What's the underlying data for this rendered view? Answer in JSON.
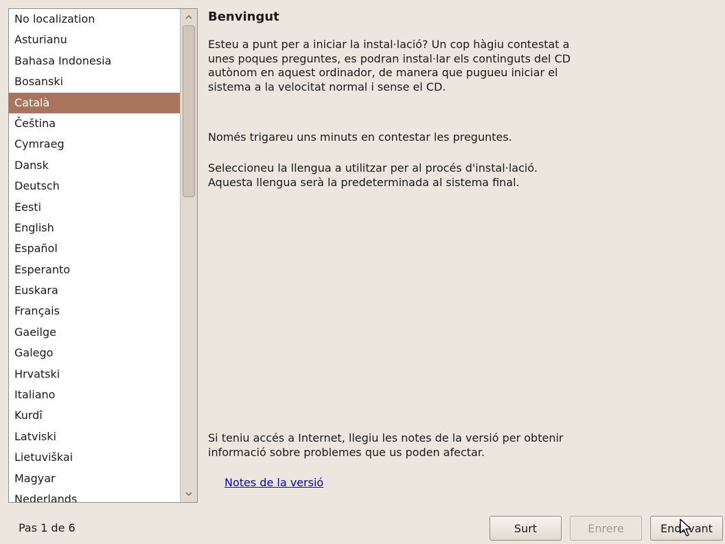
{
  "languages": [
    "No localization",
    "Asturianu",
    "Bahasa Indonesia",
    "Bosanski",
    "Català",
    "Čeština",
    "Cymraeg",
    "Dansk",
    "Deutsch",
    "Eesti",
    "English",
    "Español",
    "Esperanto",
    "Euskara",
    "Français",
    "Gaeilge",
    "Galego",
    "Hrvatski",
    "Italiano",
    "Kurdî",
    "Latviski",
    "Lietuviškai",
    "Magyar",
    "Nederlands"
  ],
  "selected_language": "Català",
  "welcome": {
    "title": "Benvingut",
    "para1": "Esteu a punt per a iniciar la instal·lació? Un cop hàgiu contestat a unes poques preguntes, es podran instal·lar els continguts del CD autònom en aquest ordinador, de manera que pugueu iniciar el sistema a la velocitat normal i sense el CD.",
    "para2": "Només trigareu uns minuts en contestar les preguntes.",
    "para3": "Seleccioneu la llengua a utilitzar per al procés d'instal·lació. Aquesta llengua serà la predeterminada al sistema final.",
    "para4": "Si teniu accés a Internet, llegiu les notes de la versió per obtenir informació sobre problemes que us poden afectar.",
    "release_notes_link": "Notes de la versió"
  },
  "status": {
    "step": "Pas 1 de 6"
  },
  "buttons": {
    "quit": "Surt",
    "back": "Enrere",
    "forward": "Endavant"
  },
  "colors": {
    "selection": "#a8745b",
    "background": "#ede6de",
    "link": "#0000ee"
  },
  "icons": [
    "scroll-up-arrow-icon",
    "scroll-down-arrow-icon",
    "mouse-cursor-icon"
  ]
}
